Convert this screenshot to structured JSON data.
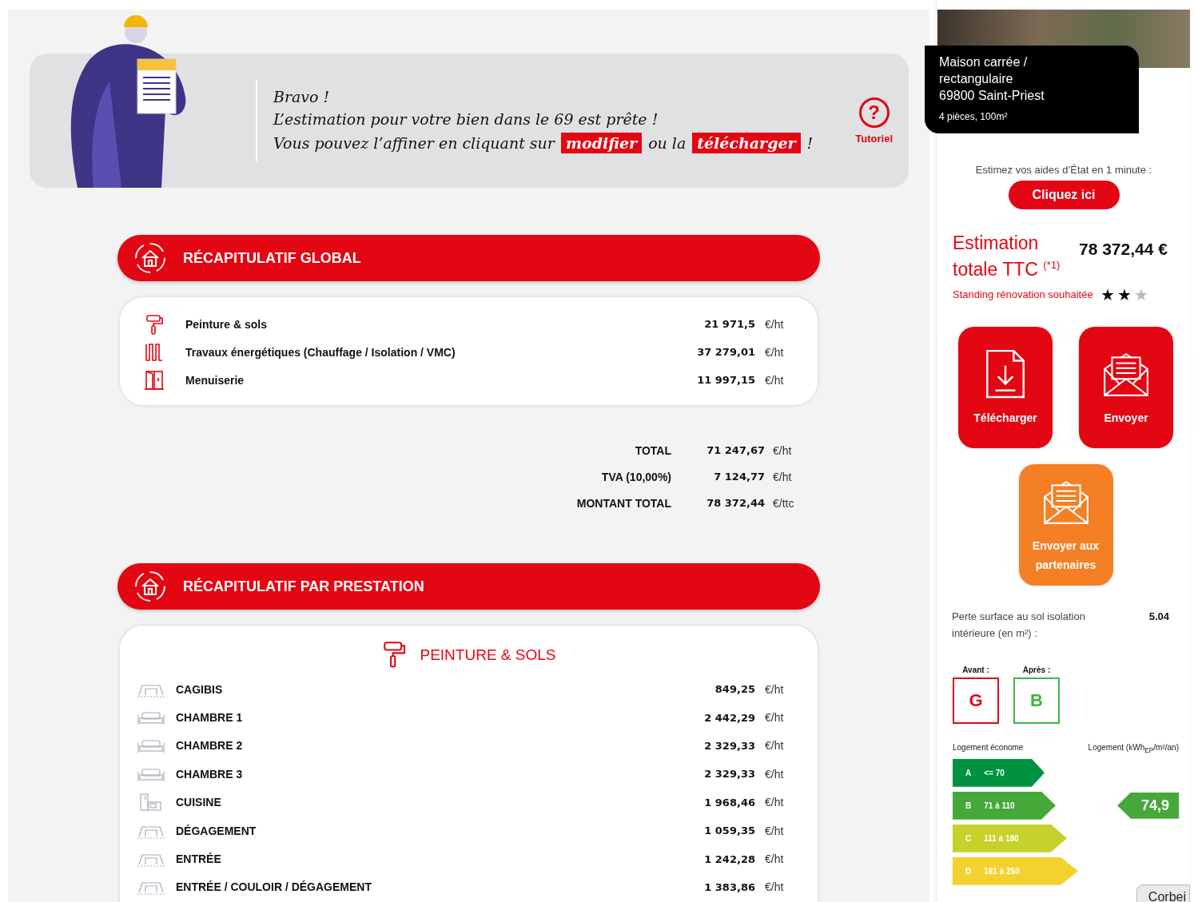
{
  "banner": {
    "lines": [
      "Bravo !",
      "L’estimation pour votre bien dans le 69 est prête !"
    ],
    "action_line": [
      {
        "kind": "text",
        "text": "Vous pouvez l’affiner en cliquant sur"
      },
      {
        "kind": "link",
        "text": "modifier"
      },
      {
        "kind": "text",
        "text": "ou la"
      },
      {
        "kind": "link",
        "text": "télécharger"
      },
      {
        "kind": "text",
        "text": "!"
      }
    ],
    "help": {
      "label": "Tutoriel",
      "icon_text": "?"
    }
  },
  "global_summary": {
    "title": "RÉCAPITULATIF GLOBAL",
    "items": [
      {
        "kind": "roller",
        "label": "Peinture & sols",
        "value": "21 971,5",
        "unit": "€/ht"
      },
      {
        "kind": "radiator",
        "label": "Travaux énergétiques (Chauffage / Isolation / VMC)",
        "value": "37 279,01",
        "unit": "€/ht"
      },
      {
        "kind": "door",
        "label": "Menuiserie",
        "value": "11 997,15",
        "unit": "€/ht"
      }
    ],
    "totals": [
      {
        "label": "TOTAL",
        "value": "71 247,67",
        "unit": "€/ht"
      },
      {
        "label": "TVA (10,00%)",
        "value": "7 124,77",
        "unit": "€/ht"
      },
      {
        "label": "MONTANT TOTAL",
        "value": "78 372,44",
        "unit": "€/ttc"
      }
    ]
  },
  "service_summary": {
    "title": "RÉCAPITULATIF PAR PRESTATION",
    "category": "PEINTURE & SOLS",
    "rows": [
      {
        "kind": "room",
        "label": "CAGIBIS",
        "value": "849,25",
        "unit": "€/ht"
      },
      {
        "kind": "bedroom",
        "label": "CHAMBRE 1",
        "value": "2 442,29",
        "unit": "€/ht"
      },
      {
        "kind": "bedroom",
        "label": "CHAMBRE 2",
        "value": "2 329,33",
        "unit": "€/ht"
      },
      {
        "kind": "bedroom",
        "label": "CHAMBRE 3",
        "value": "2 329,33",
        "unit": "€/ht"
      },
      {
        "kind": "kitchen",
        "label": "CUISINE",
        "value": "1 968,46",
        "unit": "€/ht"
      },
      {
        "kind": "room",
        "label": "DÉGAGEMENT",
        "value": "1 059,35",
        "unit": "€/ht"
      },
      {
        "kind": "room",
        "label": "ENTRÉE",
        "value": "1 242,28",
        "unit": "€/ht"
      },
      {
        "kind": "room",
        "label": "ENTRÉE / COULOIR / DÉGAGEMENT",
        "value": "1 383,86",
        "unit": "€/ht"
      }
    ]
  },
  "property": {
    "type": "Maison carrée / rectangulaire",
    "address": "69800 Saint-Priest",
    "details": "4 pièces, 100m²"
  },
  "aid": {
    "prompt": "Estimez vos aides d’État en 1 minute :",
    "button": "Cliquez ici"
  },
  "estimate": {
    "title": "Estimation totale TTC $^{(*1)}$",
    "amount": "78 372,44 €",
    "standing_label": "Standing rénovation souhaitée",
    "stars": 2
  },
  "actions": [
    {
      "kind": "download",
      "label": "Télécharger",
      "color": "#e30613"
    },
    {
      "kind": "mail",
      "label": "Envoyer",
      "color": "#e30613"
    },
    {
      "kind": "mail",
      "label": "Envoyer aux partenaires",
      "color": "#f47f24"
    }
  ],
  "floor_loss": {
    "label": "Perte surface au sol isolation intérieure (en m²) :",
    "value": "5.04"
  },
  "grades": [
    {
      "label": "Avant :",
      "grade": "G",
      "color": "#e30613"
    },
    {
      "label": "Après :",
      "grade": "B",
      "color": "#3fb34a"
    }
  ],
  "energy": {
    "left_label": "Logement économe",
    "right_label": "Logement (kWh$_{EP}$/m²/an)",
    "reading": "74,9",
    "classes": [
      {
        "letter": "A",
        "range": "<= 70",
        "color": "#00923f",
        "selected": false
      },
      {
        "letter": "B",
        "range": "71 à 110",
        "color": "#45a839",
        "selected": true
      },
      {
        "letter": "C",
        "range": "111 à 180",
        "color": "#c6d22c",
        "selected": false
      },
      {
        "letter": "D",
        "range": "181 à 250",
        "color": "#f3d12f",
        "selected": false
      }
    ]
  },
  "dock_tooltip": "Corbei"
}
